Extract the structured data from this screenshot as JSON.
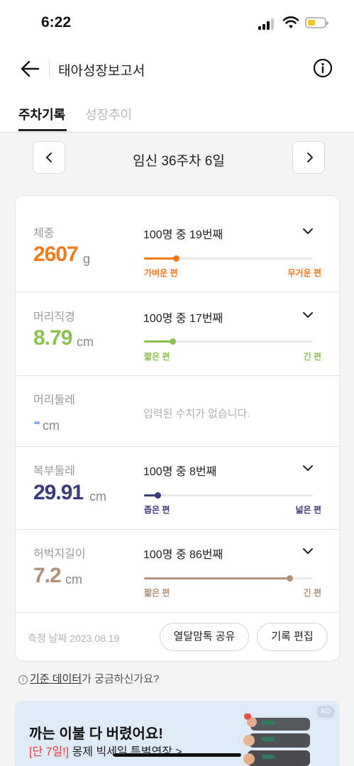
{
  "status_bar": {
    "time": "6:22"
  },
  "header": {
    "title": "태아성장보고서"
  },
  "tabs": [
    {
      "label": "주차기록",
      "active": true
    },
    {
      "label": "성장추이",
      "active": false
    }
  ],
  "week": {
    "label": "임신 36주차 6일"
  },
  "measurements": [
    {
      "label": "체중",
      "value": "2607",
      "unit": "g",
      "rank": "100명 중 19번째",
      "scale_low": "가벼운 편",
      "scale_high": "무거운 편",
      "percentile": 0.19,
      "color": "#f07a1a"
    },
    {
      "label": "머리직경",
      "value": "8.79",
      "unit": "cm",
      "rank": "100명 중 17번째",
      "scale_low": "짧은 편",
      "scale_high": "긴 편",
      "percentile": 0.17,
      "color": "#8cc152"
    },
    {
      "label": "머리둘레",
      "value": "-",
      "unit": "cm",
      "empty_message": "입력된 수치가 없습니다.",
      "color": "#7fa7e0"
    },
    {
      "label": "복부둘레",
      "value": "29.91",
      "unit": "cm",
      "rank": "100명 중 8번째",
      "scale_low": "좁은 편",
      "scale_high": "넓은 편",
      "percentile": 0.08,
      "color": "#3b3a7a"
    },
    {
      "label": "허벅지길이",
      "value": "7.2",
      "unit": "cm",
      "rank": "100명 중 86번째",
      "scale_low": "짧은 편",
      "scale_high": "긴 편",
      "percentile": 0.86,
      "color": "#b0927a"
    }
  ],
  "footer": {
    "date": "측정 날짜 2023.08.19",
    "share_button": "열달맘톡 공유",
    "edit_button": "기록 편집"
  },
  "info_link": {
    "icon": "i",
    "link_text": "기준 데이터",
    "suffix": "가 궁금하신가요?"
  },
  "ad": {
    "badge": "AD",
    "title": "까는 이불 다 버렸어요!",
    "highlight": "[단 7일!]",
    "subtitle": " 몽제 빅세일 특별연장 >"
  },
  "icons": [
    "back-arrow-icon",
    "info-icon",
    "chevron-left-icon",
    "chevron-right-icon",
    "chevron-down-icon",
    "signal-icon",
    "wifi-icon",
    "battery-icon",
    "mattress-image"
  ]
}
